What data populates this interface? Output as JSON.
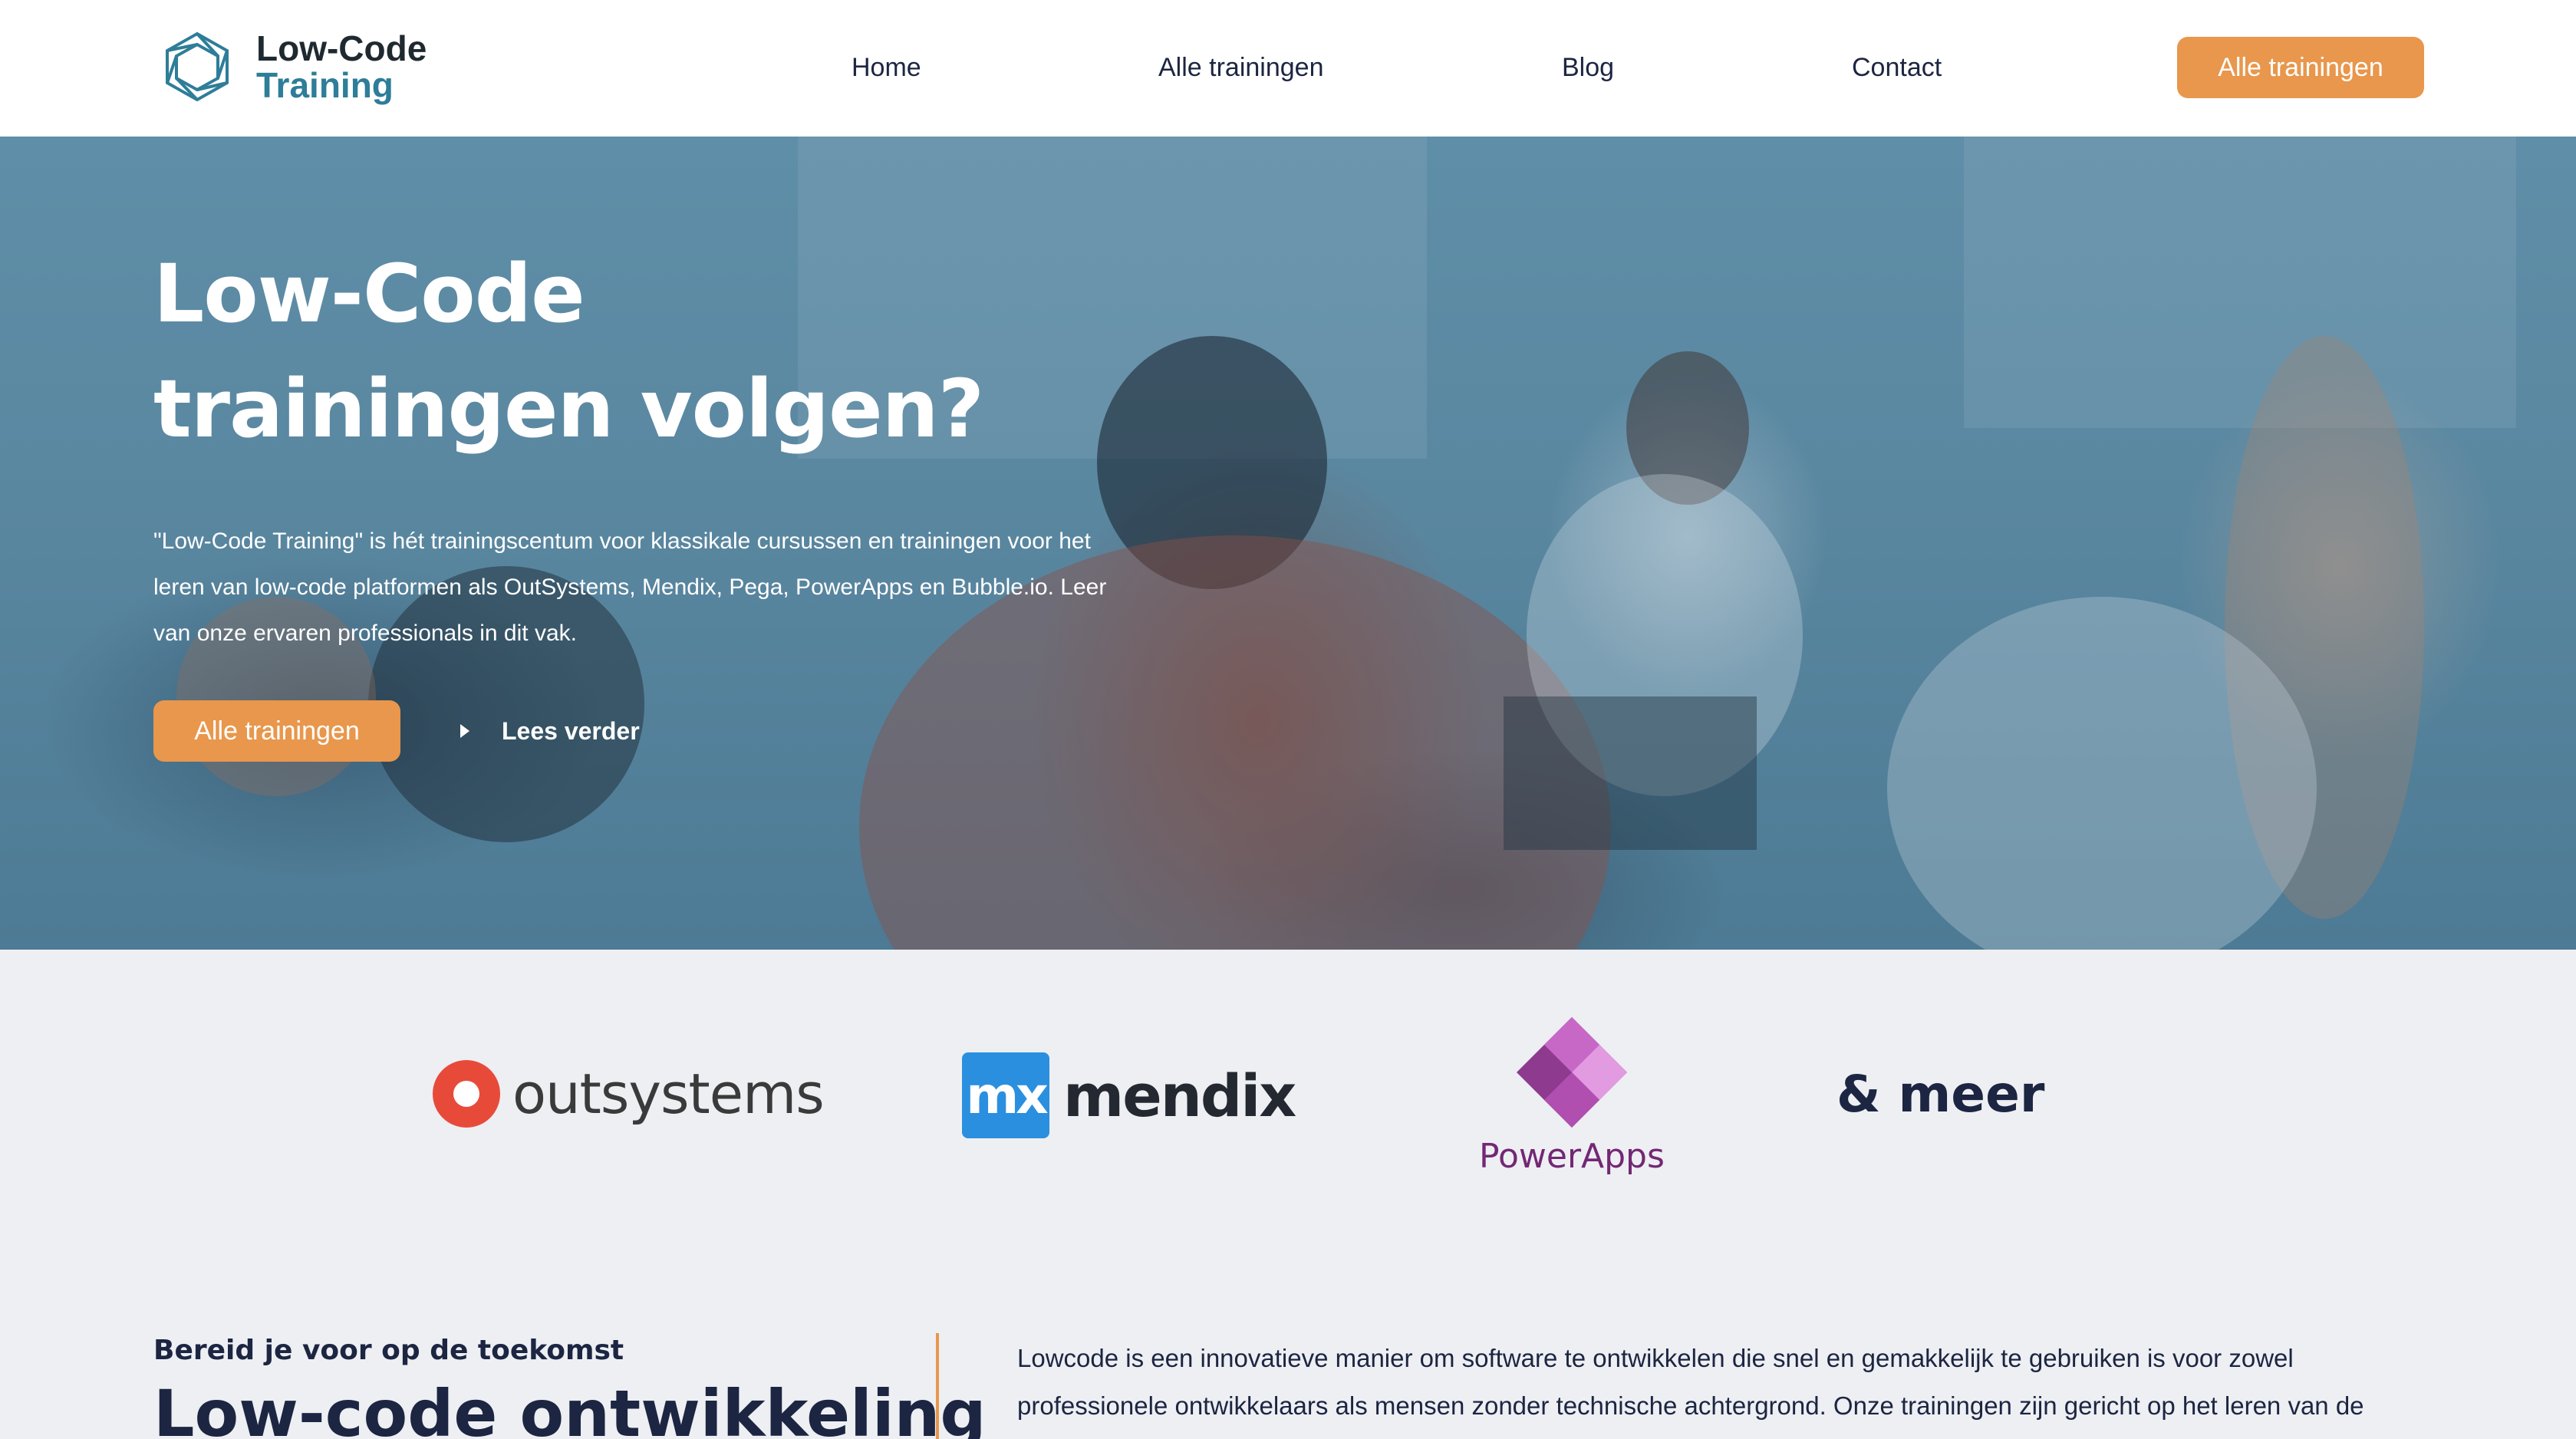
{
  "header": {
    "logo_line1": "Low-Code",
    "logo_line2": "Training",
    "nav": [
      "Home",
      "Alle trainingen",
      "Blog",
      "Contact"
    ],
    "cta_label": "Alle trainingen"
  },
  "hero": {
    "title_line1": "Low-Code",
    "title_line2": "trainingen volgen?",
    "text": "\"Low-Code Training\" is hét trainingscentum voor klassikale cursussen en trainingen voor het leren van low-code platformen als OutSystems, Mendix, Pega, PowerApps en Bubble.io. Leer van onze ervaren professionals in dit vak.",
    "cta_label": "Alle trainingen",
    "read_more_label": "Lees verder"
  },
  "platforms": {
    "outsystems": "outsystems",
    "mendix_mark": "mx",
    "mendix": "mendix",
    "powerapps": "PowerApps",
    "more": "& meer"
  },
  "intro": {
    "eyebrow": "Bereid je voor op de toekomst",
    "title": "Low-code ontwikkeling",
    "body": "Lowcode is een innovatieve manier om software te ontwikkelen die snel en gemakkelijk te gebruiken is voor zowel professionele ontwikkelaars als mensen zonder technische achtergrond. Onze trainingen zijn gericht op het leren van de"
  },
  "colors": {
    "accent_orange": "#e8974c",
    "navy_text": "#1c2541",
    "brand_teal": "#2e7d99",
    "hero_overlay": "#5a87a0",
    "strip_bg": "#edeff3"
  }
}
